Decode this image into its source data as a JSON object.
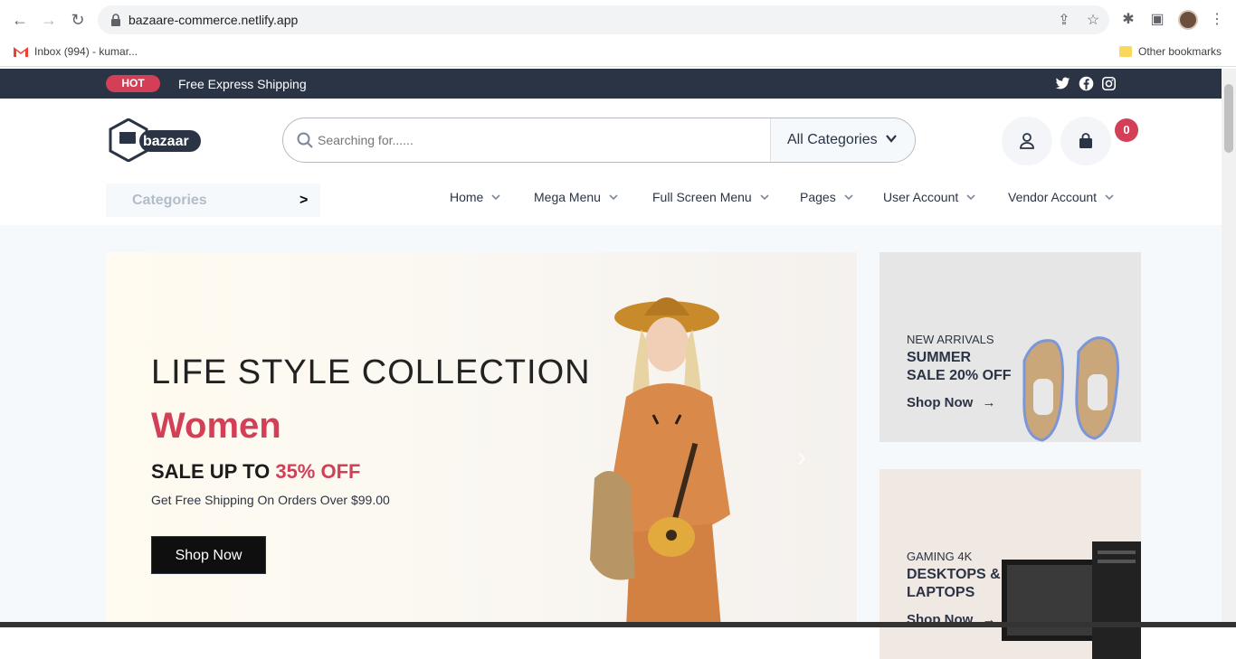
{
  "browser": {
    "url": "bazaare-commerce.netlify.app",
    "bookmarks": [
      {
        "label": "Inbox (994) - kumar..."
      },
      {
        "label": "Other bookmarks"
      }
    ]
  },
  "topbar": {
    "hot_label": "HOT",
    "shipping_text": "Free Express Shipping"
  },
  "header": {
    "logo_text": "bazaar",
    "search_placeholder": "Searching for......",
    "category_select": "All Categories",
    "cart_count": "0"
  },
  "nav": {
    "categories_label": "Categories",
    "categories_arrow": ">",
    "items": [
      {
        "label": "Home"
      },
      {
        "label": "Mega Menu"
      },
      {
        "label": "Full Screen Menu"
      },
      {
        "label": "Pages"
      },
      {
        "label": "User Account"
      },
      {
        "label": "Vendor Account"
      }
    ]
  },
  "hero": {
    "headline": "LIFE STYLE COLLECTION",
    "subhead": "Women",
    "sale_prefix": "SALE UP TO ",
    "sale_pct": "35% OFF",
    "desc": "Get Free Shipping On Orders Over $99.00",
    "cta": "Shop Now"
  },
  "promos": [
    {
      "kicker": "NEW ARRIVALS",
      "title_line1": "SUMMER",
      "title_line2": "SALE 20% OFF",
      "link": "Shop Now"
    },
    {
      "kicker": "GAMING 4K",
      "title_line1": "DESKTOPS &",
      "title_line2": "LAPTOPS",
      "link": "Shop Now"
    }
  ],
  "colors": {
    "accent": "#d23f57",
    "topbar_bg": "#2b3445",
    "promo1_bg": "#e6e6e6",
    "promo2_bg": "#f0e8e2"
  }
}
